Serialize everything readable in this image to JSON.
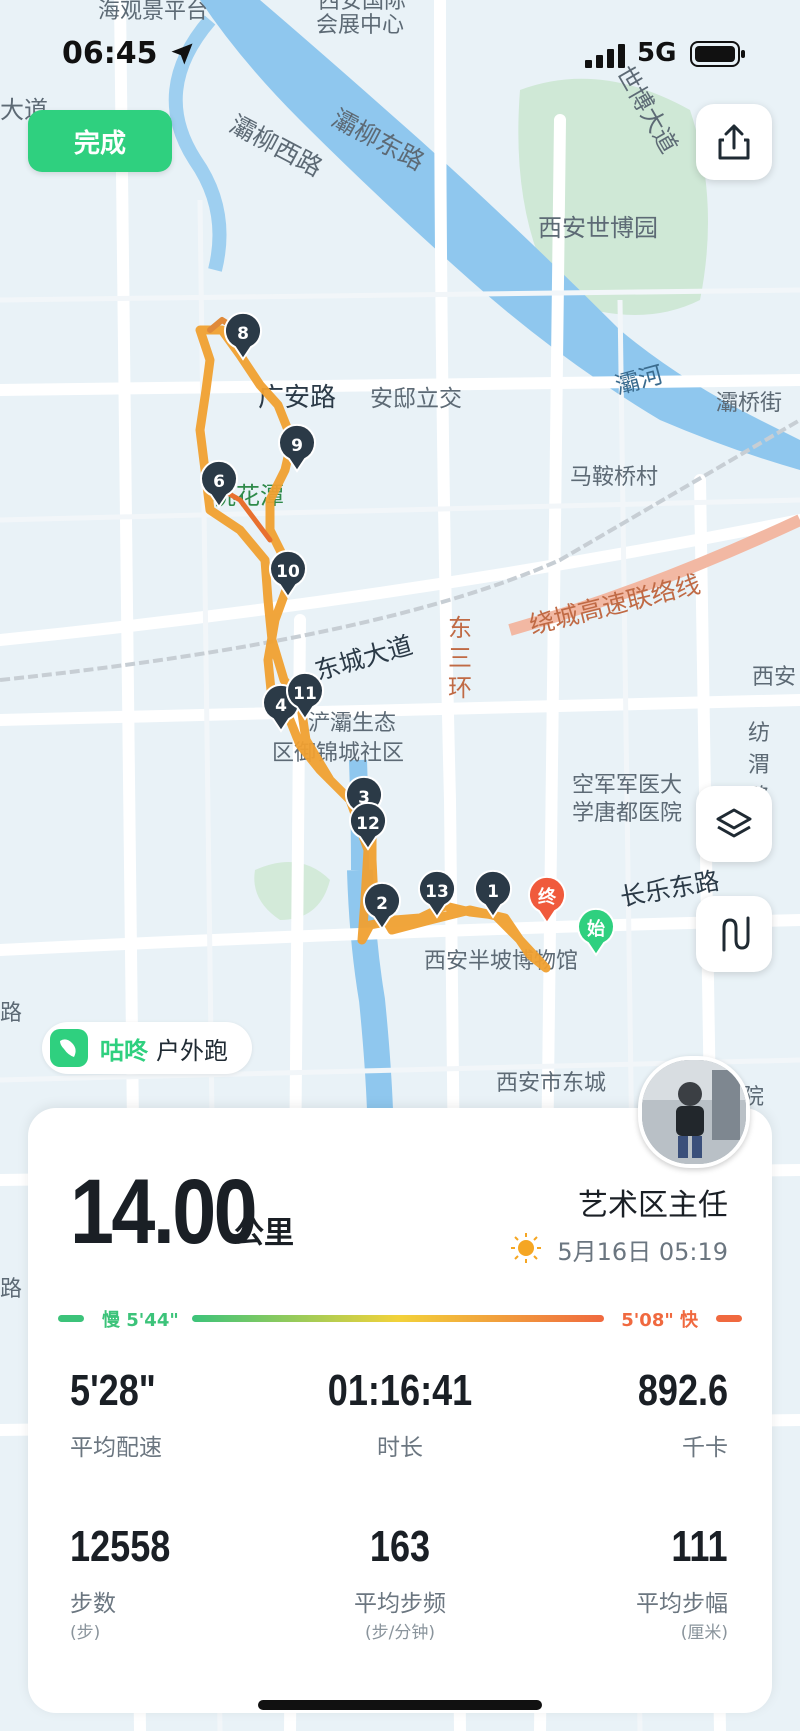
{
  "status_bar": {
    "time": "06:45",
    "network": "5G"
  },
  "header": {
    "done_label": "完成"
  },
  "map": {
    "labels": {
      "ba_willow_west_rd": "灞柳西路",
      "ba_willow_east_rd": "灞柳东路",
      "expo_park": "西安世博园",
      "expo_avenue": "世博大道",
      "ba_river": "灞河",
      "guangan_rd": "广安路",
      "anqiu_interchange": "安邸立交",
      "peach_pool": "桃花潭",
      "maanqiao": "马鞍桥村",
      "ring_expressway": "绕城高速联络线",
      "east_third_ring": "东三环",
      "dongcheng_ave": "东城大道",
      "eco_zone_a": "浐灞生态",
      "eco_zone_b": "区御锦城社区",
      "airforce_a": "空军军医大",
      "airforce_b": "学唐都医院",
      "changle_east_rd": "长乐东路",
      "banpo_museum": "西安半坡博物馆",
      "school": "西安市东城",
      "fangwei": "纺渭路",
      "xian_right": "西安",
      "top_a": "海观景平台",
      "top_b": "会展中心",
      "top_c": "西安国际",
      "left_dao": "大道",
      "bahqiao_st": "灞桥街"
    },
    "markers": [
      "1",
      "2",
      "3",
      "4",
      "6",
      "8",
      "9",
      "10",
      "11",
      "12",
      "13"
    ],
    "start_label": "始",
    "end_label": "终",
    "colors": {
      "route": "#f0a030",
      "start": "#2fd07f",
      "end": "#f05a3c",
      "marker": "#2b3a47"
    }
  },
  "brand": {
    "name": "咕咚",
    "activity_type": "户外跑"
  },
  "summary": {
    "distance_value": "14.00",
    "distance_unit": "公里",
    "username": "艺术区主任",
    "datetime": "5月16日 05:19",
    "pace_slow_label": "慢 5'44\"",
    "pace_fast_label": "5'08\" 快"
  },
  "stats": [
    {
      "value": "5'28\"",
      "label": "平均配速",
      "unit": ""
    },
    {
      "value": "01:16:41",
      "label": "时长",
      "unit": ""
    },
    {
      "value": "892.6",
      "label": "千卡",
      "unit": ""
    },
    {
      "value": "12558",
      "label": "步数",
      "unit": "(步)"
    },
    {
      "value": "163",
      "label": "平均步频",
      "unit": "(步/分钟)"
    },
    {
      "value": "111",
      "label": "平均步幅",
      "unit": "(厘米)"
    }
  ]
}
